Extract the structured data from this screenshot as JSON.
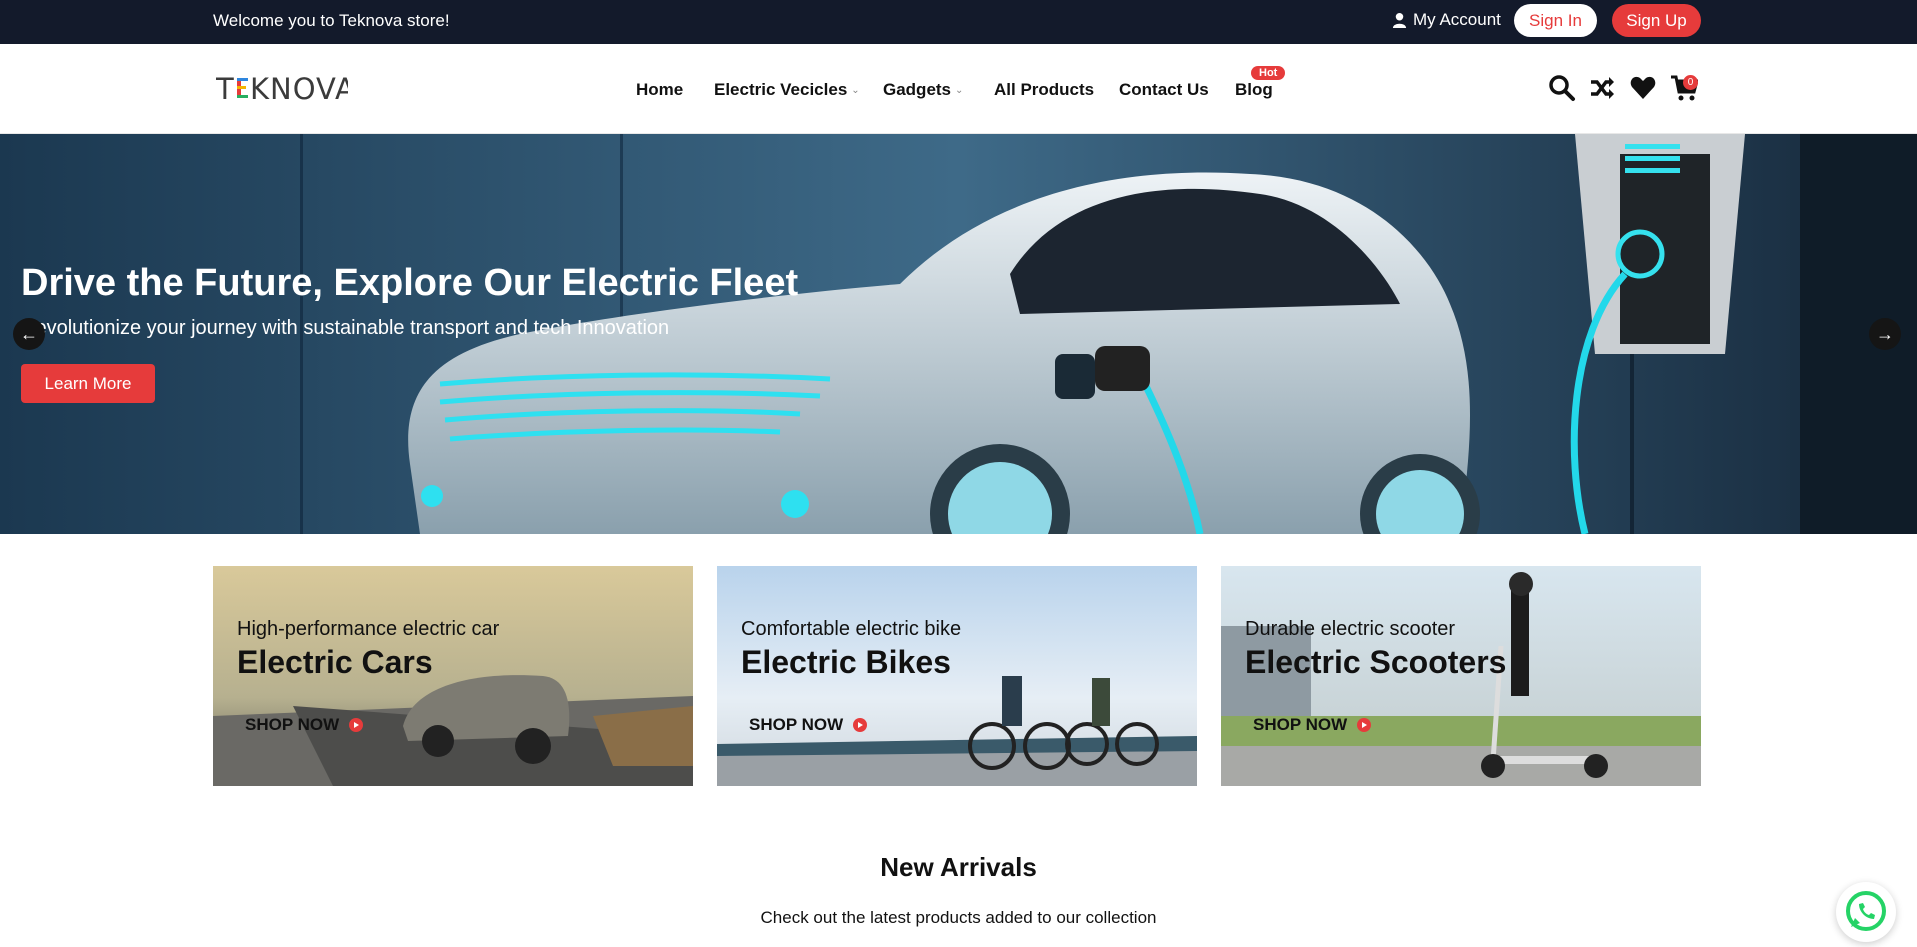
{
  "topbar": {
    "welcome": "Welcome you to Teknova store!",
    "account_label": "My Account",
    "signin_label": "Sign In",
    "signup_label": "Sign Up"
  },
  "header": {
    "logo": "TEKNOVA",
    "nav": [
      {
        "label": "Home"
      },
      {
        "label": "Electric Vecicles"
      },
      {
        "label": "Gadgets"
      },
      {
        "label": "All Products"
      },
      {
        "label": "Contact Us"
      },
      {
        "label": "Blog"
      }
    ],
    "hot_badge": "Hot",
    "icons": [
      "search-icon",
      "shuffle-icon",
      "heart-icon",
      "cart-icon"
    ],
    "cart_count": "0"
  },
  "hero": {
    "title": "Drive the Future, Explore Our Electric Fleet",
    "subtitle": "Revolutionize your journey with sustainable transport and tech Innovation",
    "button_label": "Learn More"
  },
  "categories": [
    {
      "subtitle": "High-performance electric car",
      "title": "Electric Cars",
      "cta": "SHOP NOW"
    },
    {
      "subtitle": "Comfortable electric bike",
      "title": "Electric Bikes",
      "cta": "SHOP NOW"
    },
    {
      "subtitle": "Durable electric scooter",
      "title": "Electric Scooters",
      "cta": "SHOP NOW"
    }
  ],
  "new_arrivals": {
    "title": "New Arrivals",
    "subtitle": "Check out the latest products added to our collection"
  },
  "colors": {
    "accent": "#e63b3b",
    "topbar": "#131a2b"
  }
}
